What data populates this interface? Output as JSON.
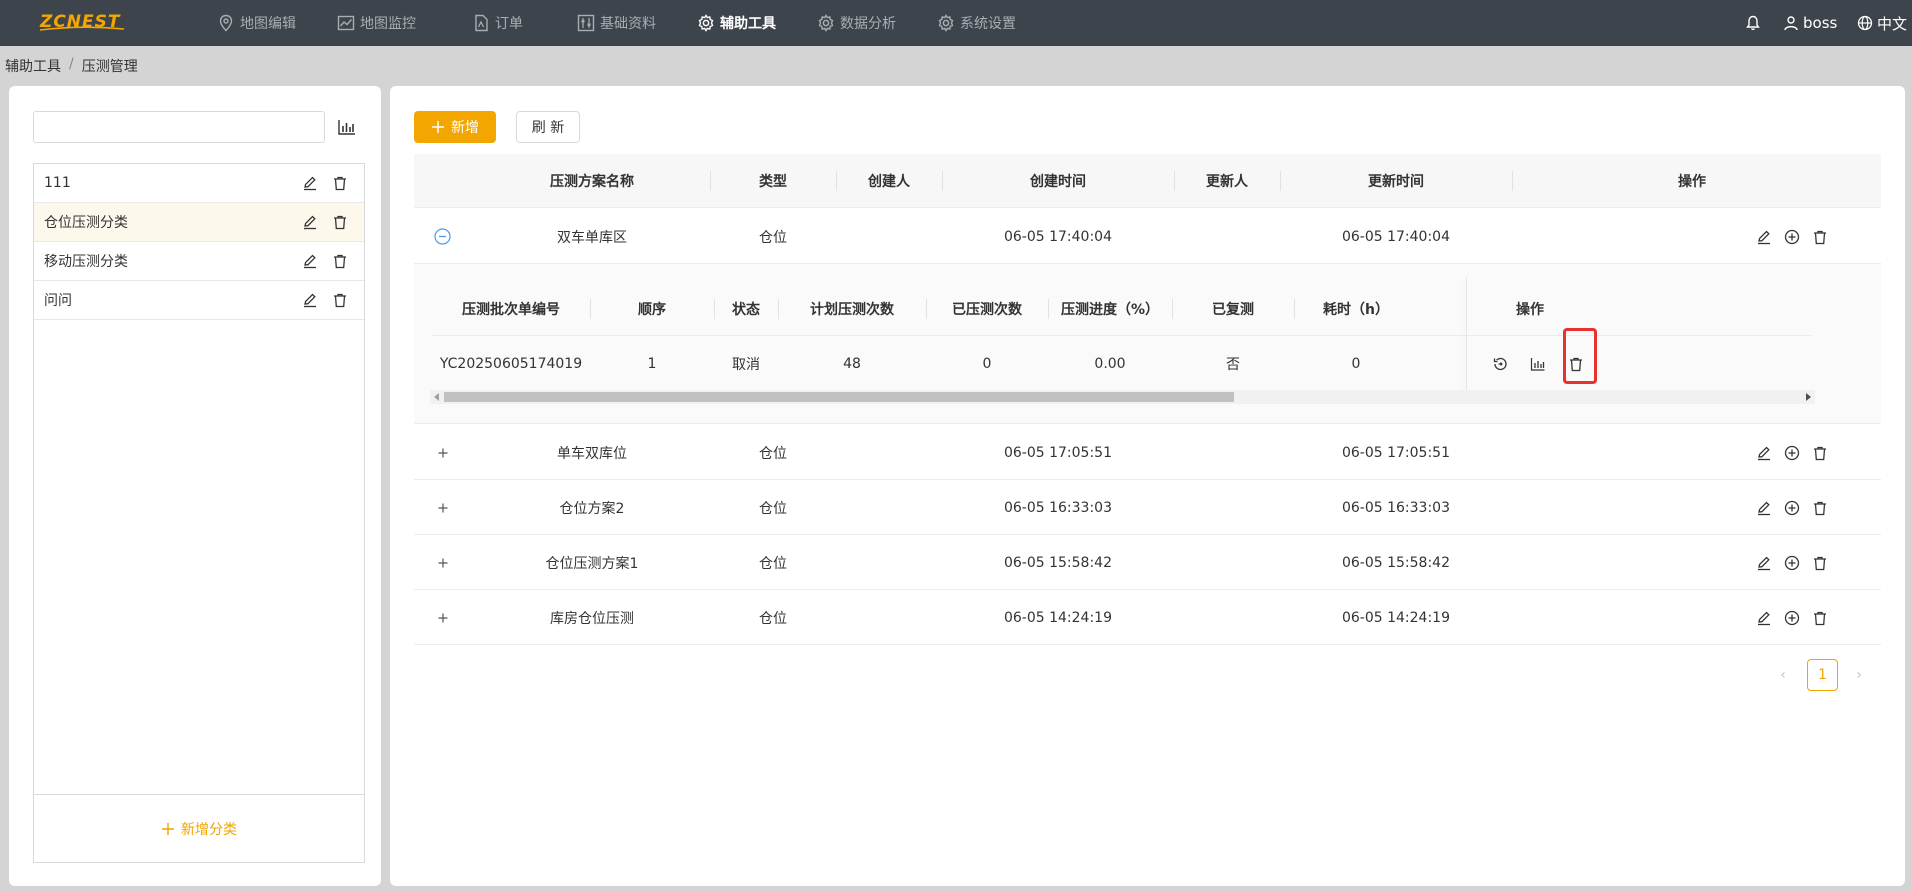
{
  "brand": {
    "logo_text": "ZCNEST",
    "accent": "#f4a600",
    "nav_bg": "#3e444c"
  },
  "nav": {
    "items": [
      {
        "label": "地图编辑",
        "icon": "location-pin-icon"
      },
      {
        "label": "地图监控",
        "icon": "chart-line-icon"
      },
      {
        "label": "订单",
        "icon": "document-icon"
      },
      {
        "label": "基础资料",
        "icon": "sliders-icon"
      },
      {
        "label": "辅助工具",
        "icon": "gear-icon",
        "active": true
      },
      {
        "label": "数据分析",
        "icon": "gear-icon"
      },
      {
        "label": "系统设置",
        "icon": "gear-icon"
      }
    ],
    "user": "boss",
    "language": "中文"
  },
  "breadcrumb": {
    "root": "辅助工具",
    "sep": "/",
    "current": "压测管理"
  },
  "sidebar": {
    "search_value": "",
    "categories": [
      {
        "label": "111"
      },
      {
        "label": "仓位压测分类",
        "selected": true
      },
      {
        "label": "移动压测分类"
      },
      {
        "label": "问问"
      }
    ],
    "add_label": "新增分类"
  },
  "toolbar": {
    "add_label": "新增",
    "refresh_label": "刷 新"
  },
  "table": {
    "headers": {
      "name": "压测方案名称",
      "type": "类型",
      "creator": "创建人",
      "created": "创建时间",
      "updater": "更新人",
      "updated": "更新时间",
      "ops": "操作"
    },
    "rows": [
      {
        "name": "双车单库区",
        "type": "仓位",
        "creator": "",
        "created": "06-05 17:40:04",
        "updater": "",
        "updated": "06-05 17:40:04",
        "expanded": true
      },
      {
        "name": "单车双库位",
        "type": "仓位",
        "creator": "",
        "created": "06-05 17:05:51",
        "updater": "",
        "updated": "06-05 17:05:51"
      },
      {
        "name": "仓位方案2",
        "type": "仓位",
        "creator": "",
        "created": "06-05 16:33:03",
        "updater": "",
        "updated": "06-05 16:33:03"
      },
      {
        "name": "仓位压测方案1",
        "type": "仓位",
        "creator": "",
        "created": "06-05 15:58:42",
        "updater": "",
        "updated": "06-05 15:58:42"
      },
      {
        "name": "库房仓位压测",
        "type": "仓位",
        "creator": "",
        "created": "06-05 14:24:19",
        "updater": "",
        "updated": "06-05 14:24:19"
      }
    ]
  },
  "subtable": {
    "headers": {
      "batch": "压测批次单编号",
      "order": "顺序",
      "status": "状态",
      "planned": "计划压测次数",
      "done": "已压测次数",
      "progress": "压测进度（%）",
      "retested": "已复测",
      "duration": "耗时（h）",
      "ops": "操作"
    },
    "rows": [
      {
        "batch": "YC20250605174019",
        "order": "1",
        "status": "取消",
        "planned": "48",
        "done": "0",
        "progress": "0.00",
        "retested": "否",
        "duration": "0"
      }
    ]
  },
  "pagination": {
    "current": "1",
    "prev": "‹",
    "next": "›"
  }
}
